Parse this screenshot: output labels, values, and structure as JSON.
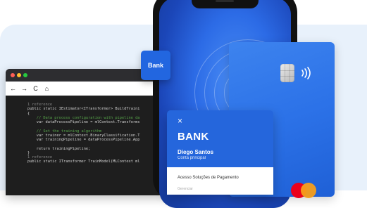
{
  "code_window": {
    "nav": {
      "back": "←",
      "forward": "→",
      "refresh": "C",
      "home": "⌂"
    },
    "lines": [
      {
        "cls": "c-ref",
        "text": "1 reference"
      },
      {
        "cls": "c-plain",
        "text": "public static IEstimator<ITransformer> BuildTraini"
      },
      {
        "cls": "c-plain",
        "text": "{"
      },
      {
        "cls": "c-cmt",
        "text": "    // Data process configuration with pipeline da"
      },
      {
        "cls": "c-plain",
        "text": "    var dataProcessPipeline = mlContext.Transforms"
      },
      {
        "cls": "c-plain",
        "text": ""
      },
      {
        "cls": "c-cmt",
        "text": "    // Set the training algorithm"
      },
      {
        "cls": "c-plain",
        "text": "    var trainer = mlContext.BinaryClassification.T"
      },
      {
        "cls": "c-plain",
        "text": "    var trainingPipeline = dataProcessPipeline.App"
      },
      {
        "cls": "c-plain",
        "text": ""
      },
      {
        "cls": "c-plain",
        "text": "    return trainingPipeline;"
      },
      {
        "cls": "c-plain",
        "text": "}"
      },
      {
        "cls": "c-ref",
        "text": "1 reference"
      },
      {
        "cls": "c-plain",
        "text": "public static ITransformer TrainModel(MLContext ml"
      }
    ]
  },
  "bank_tile": {
    "label": "Bank"
  },
  "card": {
    "brand_colors": {
      "red": "#eb001b",
      "orange": "#f79e1b"
    }
  },
  "bank_panel": {
    "close": "×",
    "title": "BANK",
    "user_name": "Diego Santos",
    "account_type": "Conta principal",
    "menu_item": "Acesso Soluções de Pagamento",
    "menu_item_extra": "Gerenciar"
  },
  "colors": {
    "accent": "#2566dc",
    "background": "#e8f1fb"
  }
}
